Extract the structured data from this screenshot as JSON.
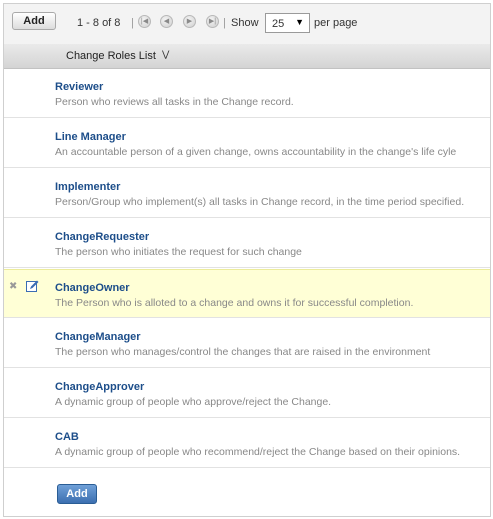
{
  "toolbar": {
    "add_label": "Add",
    "range_text": "1 - 8 of 8",
    "nav_icons": [
      "first-page-icon",
      "prev-page-icon",
      "next-page-icon",
      "last-page-icon"
    ],
    "show_label": "Show",
    "per_page_value": "25",
    "per_page_suffix": "per page"
  },
  "list_header": {
    "label": "Change Roles List"
  },
  "rows": [
    {
      "title": "Reviewer",
      "description": "Person who reviews all tasks in the Change record."
    },
    {
      "title": "Line Manager",
      "description": "An accountable person of a given change, owns accountability in the change's life cyle"
    },
    {
      "title": "Implementer",
      "description": "Person/Group who implement(s) all tasks in Change record, in the time period specified."
    },
    {
      "title": "ChangeRequester",
      "description": "The person who initiates the request for such change"
    },
    {
      "title": "ChangeOwner",
      "description": "The Person who is alloted to a change and owns it for successful completion."
    },
    {
      "title": "ChangeManager",
      "description": "The person who manages/control the changes that are raised in the environment"
    },
    {
      "title": "ChangeApprover",
      "description": "A dynamic group of people who approve/reject the Change."
    },
    {
      "title": "CAB",
      "description": "A dynamic group of people who recommend/reject the Change based on their opinions."
    }
  ],
  "footer": {
    "add_label": "Add"
  },
  "colors": {
    "title_link": "#1d4e8a",
    "selected_row": "#ffffd6",
    "primary_button": "#3c6fb0"
  }
}
